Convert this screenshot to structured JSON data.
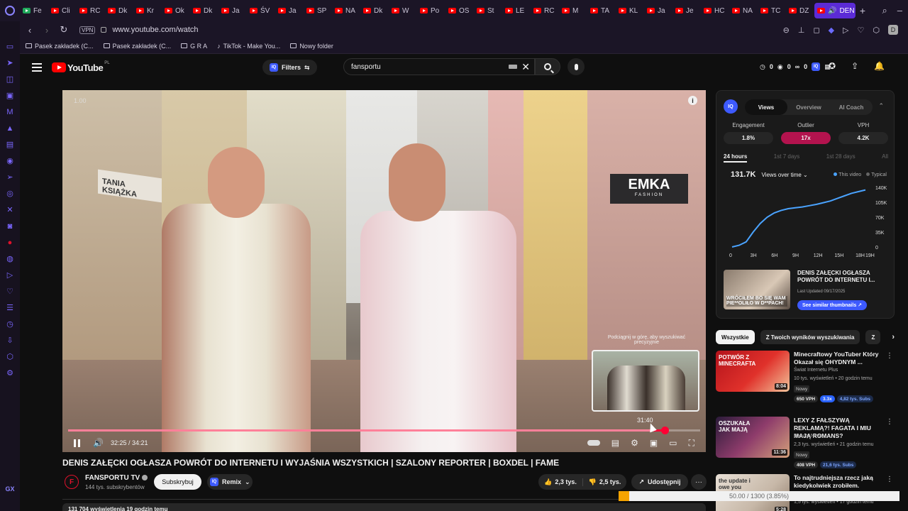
{
  "tabs": {
    "items": [
      {
        "label": "Fe"
      },
      {
        "label": "Cli"
      },
      {
        "label": "RC"
      },
      {
        "label": "Dk"
      },
      {
        "label": "Kr"
      },
      {
        "label": "Ok"
      },
      {
        "label": "Dk"
      },
      {
        "label": "Ja"
      },
      {
        "label": "ŚV"
      },
      {
        "label": "Ja"
      },
      {
        "label": "SP"
      },
      {
        "label": "NA"
      },
      {
        "label": "Dk"
      },
      {
        "label": "W"
      },
      {
        "label": "Po"
      },
      {
        "label": "OS"
      },
      {
        "label": "St"
      },
      {
        "label": "LE"
      },
      {
        "label": "RC"
      },
      {
        "label": "M"
      },
      {
        "label": "TA"
      },
      {
        "label": "KL"
      },
      {
        "label": "Ja"
      },
      {
        "label": "Je"
      },
      {
        "label": "HC"
      },
      {
        "label": "NA"
      },
      {
        "label": "TC"
      },
      {
        "label": "DZ"
      }
    ],
    "active_label": "DEN",
    "new_tab": "+"
  },
  "addressbar": {
    "vpn": "VPN",
    "url": "www.youtube.com/watch",
    "profile_letter": "D"
  },
  "bookmarks": [
    {
      "label": "Pasek zakładek (C...",
      "icon": "folder-icon"
    },
    {
      "label": "Pasek zakładek (C...",
      "icon": "folder-icon"
    },
    {
      "label": "G R A",
      "icon": "folder-icon"
    },
    {
      "label": "TikTok - Make You...",
      "icon": "tiktok-icon"
    },
    {
      "label": "Nowy folder",
      "icon": "folder-icon"
    }
  ],
  "header": {
    "logo_text": "YouTube",
    "logo_region": "PL",
    "filters_label": "Filters",
    "iq_text": "IQ",
    "search_value": "fansportu",
    "stat_a": "0",
    "stat_b": "0",
    "stat_c": "0"
  },
  "video": {
    "speed_overlay": "1.00",
    "shop_sign": "EMKA",
    "shop_sign_sub": "FASHION",
    "book_sign": "TANIA KSIĄŻKA",
    "pull_hint": "Podciągnij w górę, aby wyszukiwać precyzyjnie",
    "preview_time": "31:40",
    "time_display": "32:25 / 34:21",
    "progress_fraction": 0.944,
    "hover_fraction": 0.922,
    "colors": {
      "progress": "#ff0033"
    }
  },
  "title": "DENIS ZAŁĘCKI OGŁASZA POWRÓT DO INTERNETU I WYJAŚNIA WSZYSTKICH | SZALONY REPORTER | BOXDEL | FAME",
  "channel": {
    "avatar_letter": "F",
    "name": "FANSPORTU TV",
    "subs": "144 tys. subskrybentów",
    "subscribe_label": "Subskrybuj",
    "remix_label": "Remix",
    "likes": "2,3 tys.",
    "dislikes": "2,5 tys.",
    "share_label": "Udostępnij",
    "more": "···"
  },
  "description_strip": "131 704 wyświetlenia  19 godzin temu",
  "iq_panel": {
    "logo": "IQ",
    "tabs": [
      {
        "label": "Views",
        "active": true
      },
      {
        "label": "Overview",
        "active": false
      },
      {
        "label": "AI Coach",
        "active": false
      }
    ],
    "metrics": [
      {
        "label": "Engagement",
        "value": "1.8%"
      },
      {
        "label": "Outlier",
        "value": "17x"
      },
      {
        "label": "VPH",
        "value": "4.2K"
      }
    ],
    "ranges": [
      {
        "label": "24 hours",
        "active": true
      },
      {
        "label": "1st 7 days",
        "active": false
      },
      {
        "label": "1st 28 days",
        "active": false
      },
      {
        "label": "All",
        "active": false
      }
    ],
    "views_total": "131.7K",
    "views_label": "Views over time",
    "legend_this": "This video",
    "legend_typical": "Typical",
    "similar_btn": "See similar thumbnails",
    "thumb_title": "DENIS ZAŁĘCKI OGŁASZA POWRÓT DO INTERNETU I...",
    "thumb_updated": "Last Updated 09/17/2025",
    "thumb_overlay": "WRÓCIŁEM BO SIĘ WAM PIE**OLIŁO W D**PACH!"
  },
  "chart_data": {
    "type": "line",
    "x": [
      "0",
      "3H",
      "6H",
      "9H",
      "12H",
      "15H",
      "18H",
      "19H"
    ],
    "yticks": [
      "0",
      "35K",
      "70K",
      "105K",
      "140K"
    ],
    "ylim": [
      0,
      140000
    ],
    "series": [
      {
        "name": "This video",
        "color": "#4aa3ff",
        "points": [
          [
            0,
            0
          ],
          [
            1,
            4000
          ],
          [
            2,
            12000
          ],
          [
            3,
            35000
          ],
          [
            4,
            55000
          ],
          [
            5,
            70000
          ],
          [
            6,
            80000
          ],
          [
            7,
            86000
          ],
          [
            8,
            90000
          ],
          [
            9,
            92000
          ],
          [
            10,
            94000
          ],
          [
            11,
            97000
          ],
          [
            12,
            100000
          ],
          [
            13,
            104000
          ],
          [
            14,
            108000
          ],
          [
            15,
            114000
          ],
          [
            16,
            120000
          ],
          [
            17,
            126000
          ],
          [
            18,
            130000
          ],
          [
            19,
            134000
          ]
        ]
      }
    ],
    "grid": false
  },
  "chips": {
    "items": [
      {
        "label": "Wszystkie",
        "active": true
      },
      {
        "label": "Z Twoich wyników wyszukiwania",
        "active": false
      },
      {
        "label": "Z",
        "active": false
      }
    ],
    "next": "›"
  },
  "recs": [
    {
      "title": "Minecraftowy YouTuber Który Okazał się OHYDNYM ...",
      "channel": "Świat Internetu Plus",
      "meta": "10 tys. wyświetleń • 20 godzin temu",
      "badge": "Nowy",
      "vph": "650 VPH",
      "mult": "3.3x",
      "subs": "4,82 tys. Subs",
      "duration": "8:04",
      "thumb_text": "POTWÓR Z MINECRAFTA",
      "more": "⋮"
    },
    {
      "title": "LEXY Z FAŁSZYWĄ REKLAMĄ?! FAGATA I MIU MAJĄ ROMANS?",
      "channel": "Beauty News",
      "meta": "2,3 tys. wyświetleń • 21 godzin temu",
      "badge": "Nowy",
      "vph": "408 VPH",
      "mult": "",
      "subs": "21,6 tys. Subs",
      "duration": "11:36",
      "thumb_text": "OSZUKAŁA JAK MAJĄ",
      "more": "⋮"
    },
    {
      "title": "To najtrudniejsza rzecz jaką kiedykolwiek zrobiłem.",
      "channel": "",
      "meta": "1,5 tys. wyświetleń • 17 godzin temu",
      "badge": "",
      "vph": "",
      "mult": "",
      "subs": "",
      "duration": "5:28",
      "thumb_text": "the update i owe you",
      "more": "⋮"
    }
  ],
  "status": {
    "text": "50.00 / 1300 (3.85%)",
    "fraction": 0.0385
  }
}
